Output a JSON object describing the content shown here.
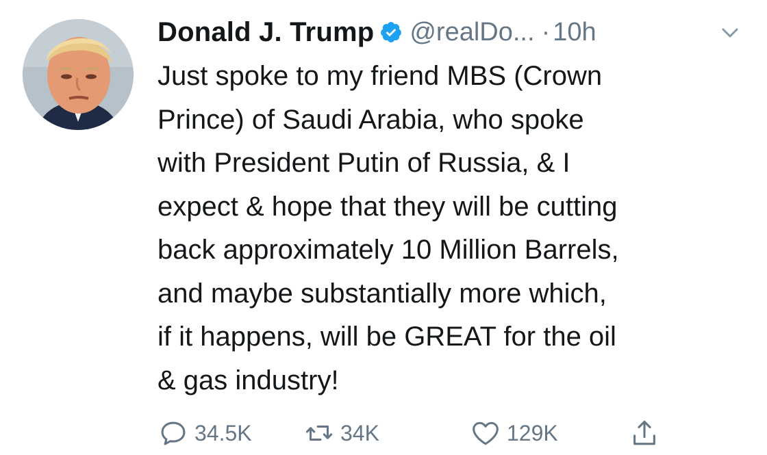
{
  "tweet": {
    "author_name": "Donald J. Trump",
    "handle": "@realDo...",
    "separator": "·",
    "time": "10h",
    "text_lines": [
      "Just spoke to my friend MBS (Crown",
      "Prince) of Saudi Arabia, who spoke",
      "with President Putin of Russia, & I",
      "expect & hope that they will be cutting",
      "back approximately 10 Million Barrels,",
      "and maybe substantially more which,",
      "if it happens, will be GREAT for the oil",
      "& gas industry!"
    ],
    "actions": {
      "replies": "34.5K",
      "retweets": "34K",
      "likes": "129K"
    }
  },
  "icons": {
    "verified": "verified-badge-icon",
    "menu": "chevron-down-icon",
    "reply": "reply-icon",
    "retweet": "retweet-icon",
    "like": "heart-icon",
    "share": "share-icon"
  },
  "colors": {
    "text": "#14171a",
    "secondary": "#657786",
    "verified": "#1da1f2"
  }
}
